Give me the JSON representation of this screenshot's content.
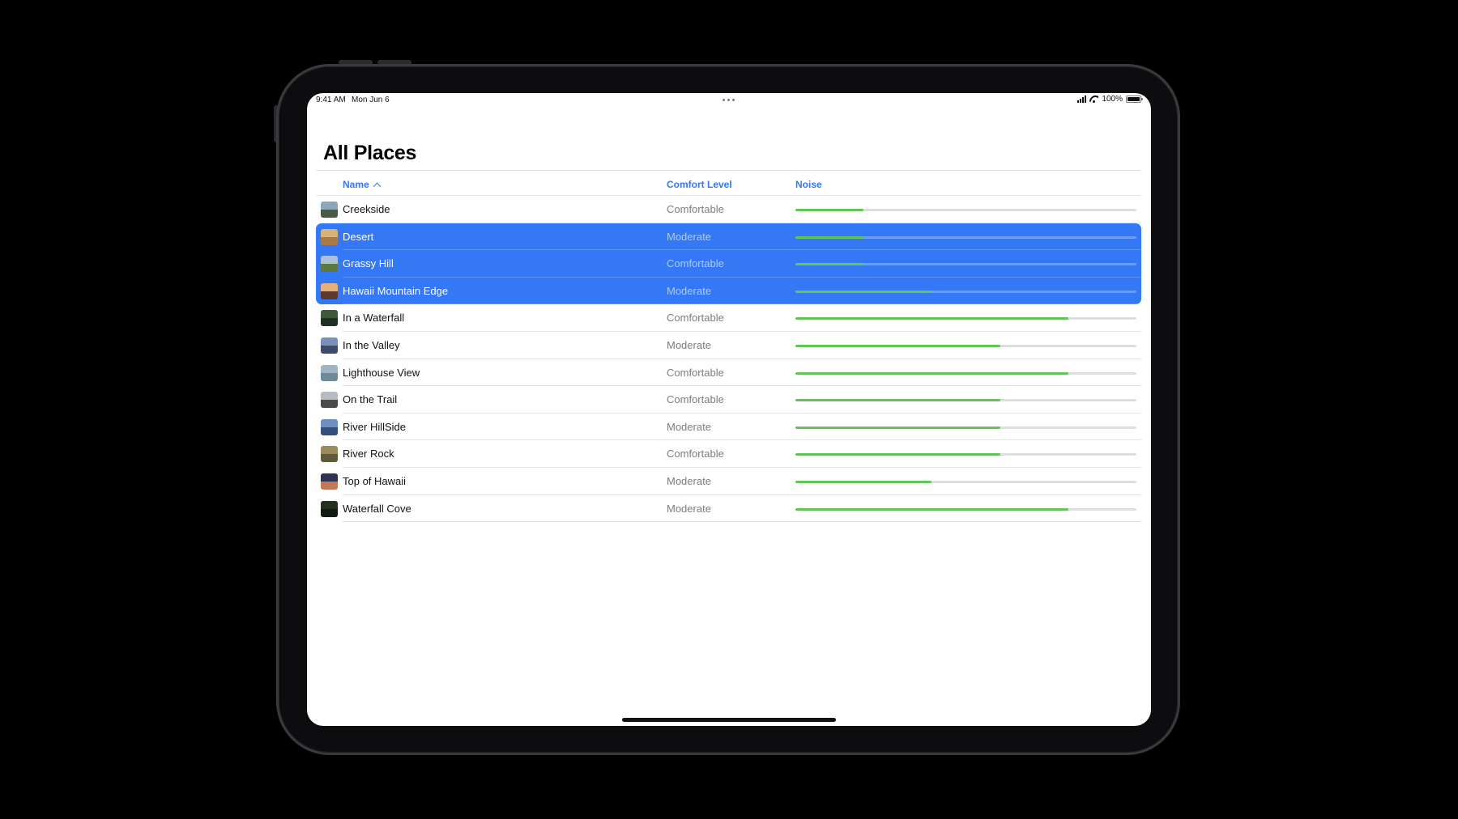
{
  "status_bar": {
    "time": "9:41 AM",
    "date": "Mon Jun 6",
    "battery": "100%"
  },
  "page": {
    "title": "All Places"
  },
  "columns": {
    "name": "Name",
    "comfort": "Comfort Level",
    "noise": "Noise"
  },
  "colors": {
    "accent": "#3478f6",
    "noise_fill": "#63c557",
    "selection": "#3478f6"
  },
  "places": [
    {
      "name": "Creekside",
      "comfort": "Comfortable",
      "noise": 0.2,
      "selected": false,
      "thumb": [
        "#8fa6b8",
        "#4b5a44"
      ]
    },
    {
      "name": "Desert",
      "comfort": "Moderate",
      "noise": 0.2,
      "selected": true,
      "thumb": [
        "#d7b27a",
        "#a97a45"
      ]
    },
    {
      "name": "Grassy Hill",
      "comfort": "Comfortable",
      "noise": 0.2,
      "selected": true,
      "thumb": [
        "#a9c1d8",
        "#5c7a3e"
      ]
    },
    {
      "name": "Hawaii Mountain Edge",
      "comfort": "Moderate",
      "noise": 0.4,
      "selected": true,
      "thumb": [
        "#e6b07a",
        "#5a3a2a"
      ]
    },
    {
      "name": "In a Waterfall",
      "comfort": "Comfortable",
      "noise": 0.8,
      "selected": false,
      "thumb": [
        "#3f5a3a",
        "#1f2f24"
      ]
    },
    {
      "name": "In the Valley",
      "comfort": "Moderate",
      "noise": 0.6,
      "selected": false,
      "thumb": [
        "#7a90b8",
        "#3d4a6a"
      ]
    },
    {
      "name": "Lighthouse View",
      "comfort": "Comfortable",
      "noise": 0.8,
      "selected": false,
      "thumb": [
        "#9fb5c4",
        "#6e8a98"
      ]
    },
    {
      "name": "On the Trail",
      "comfort": "Comfortable",
      "noise": 0.6,
      "selected": false,
      "thumb": [
        "#b7bcc2",
        "#4a4a48"
      ]
    },
    {
      "name": "River HillSide",
      "comfort": "Moderate",
      "noise": 0.6,
      "selected": false,
      "thumb": [
        "#6f8fc2",
        "#34507a"
      ]
    },
    {
      "name": "River Rock",
      "comfort": "Comfortable",
      "noise": 0.6,
      "selected": false,
      "thumb": [
        "#9a8a5e",
        "#5e5a3a"
      ]
    },
    {
      "name": "Top of Hawaii",
      "comfort": "Moderate",
      "noise": 0.4,
      "selected": false,
      "thumb": [
        "#2d3350",
        "#c07a5a"
      ]
    },
    {
      "name": "Waterfall Cove",
      "comfort": "Moderate",
      "noise": 0.8,
      "selected": false,
      "thumb": [
        "#26301f",
        "#111a12"
      ]
    }
  ]
}
